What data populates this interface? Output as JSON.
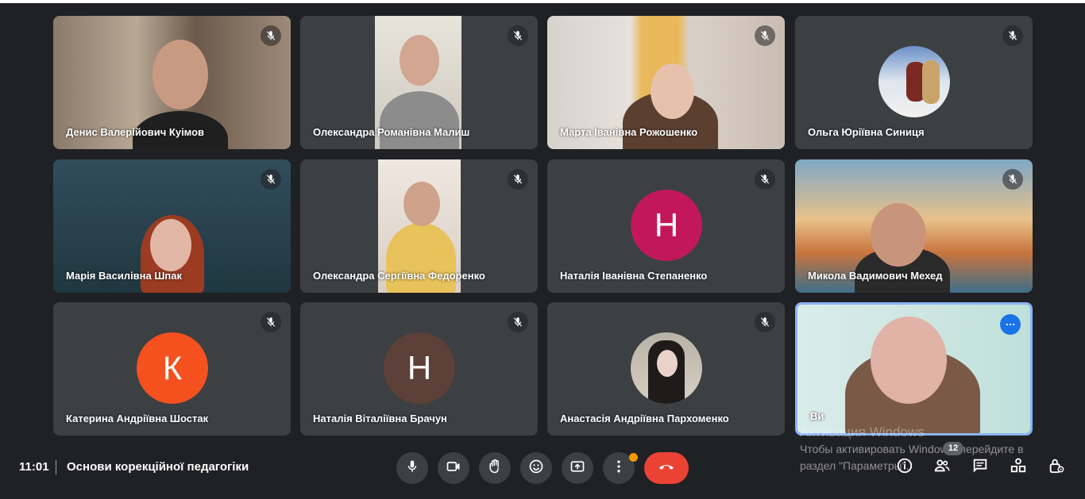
{
  "participants": [
    {
      "name": "Денис Валерійович Куімов",
      "type": "video",
      "muted": true
    },
    {
      "name": "Олександра Романівна Малиш",
      "type": "video",
      "muted": true
    },
    {
      "name": "Марта Іванівна Рожошенко",
      "type": "video",
      "muted": true
    },
    {
      "name": "Ольга Юріївна Синиця",
      "type": "photo",
      "muted": true
    },
    {
      "name": "Марія Василівна Шпак",
      "type": "video",
      "muted": true
    },
    {
      "name": "Олександра Сергіївна Федоренко",
      "type": "video",
      "muted": true
    },
    {
      "name": "Наталія Іванівна Степаненко",
      "type": "initial",
      "initial": "Н",
      "color": "#c2185b",
      "muted": true
    },
    {
      "name": "Микола Вадимович Мехед",
      "type": "video",
      "muted": true
    },
    {
      "name": "Катерина Андріївна Шостак",
      "type": "initial",
      "initial": "К",
      "color": "#f4511e",
      "muted": true
    },
    {
      "name": "Наталія Віталіївна Брачун",
      "type": "initial",
      "initial": "Н",
      "color": "#5d4037",
      "muted": true
    },
    {
      "name": "Анастасія Андріївна Пархоменко",
      "type": "photo",
      "muted": true
    },
    {
      "name": "Ви",
      "type": "video",
      "self": true,
      "muted": false
    }
  ],
  "bottom_bar": {
    "time": "11:01",
    "meeting_title": "Основи корекційної педагогіки",
    "participant_count": "12",
    "controls": [
      "mic-icon",
      "camera-icon",
      "raise-hand-icon",
      "emoji-icon",
      "present-icon",
      "more-options-icon",
      "hang-up-icon"
    ],
    "right_controls": [
      "info-icon",
      "people-icon",
      "chat-icon",
      "activities-icon",
      "host-controls-icon"
    ]
  },
  "watermark": {
    "line1": "Активация Windows",
    "line2": "Чтобы активировать Windows, перейдите в",
    "line3": "раздел \"Параметры\"."
  },
  "colors": {
    "background": "#202124",
    "tile": "#3c4043",
    "hangup": "#ea4335",
    "self_border": "#8ab4f8"
  }
}
